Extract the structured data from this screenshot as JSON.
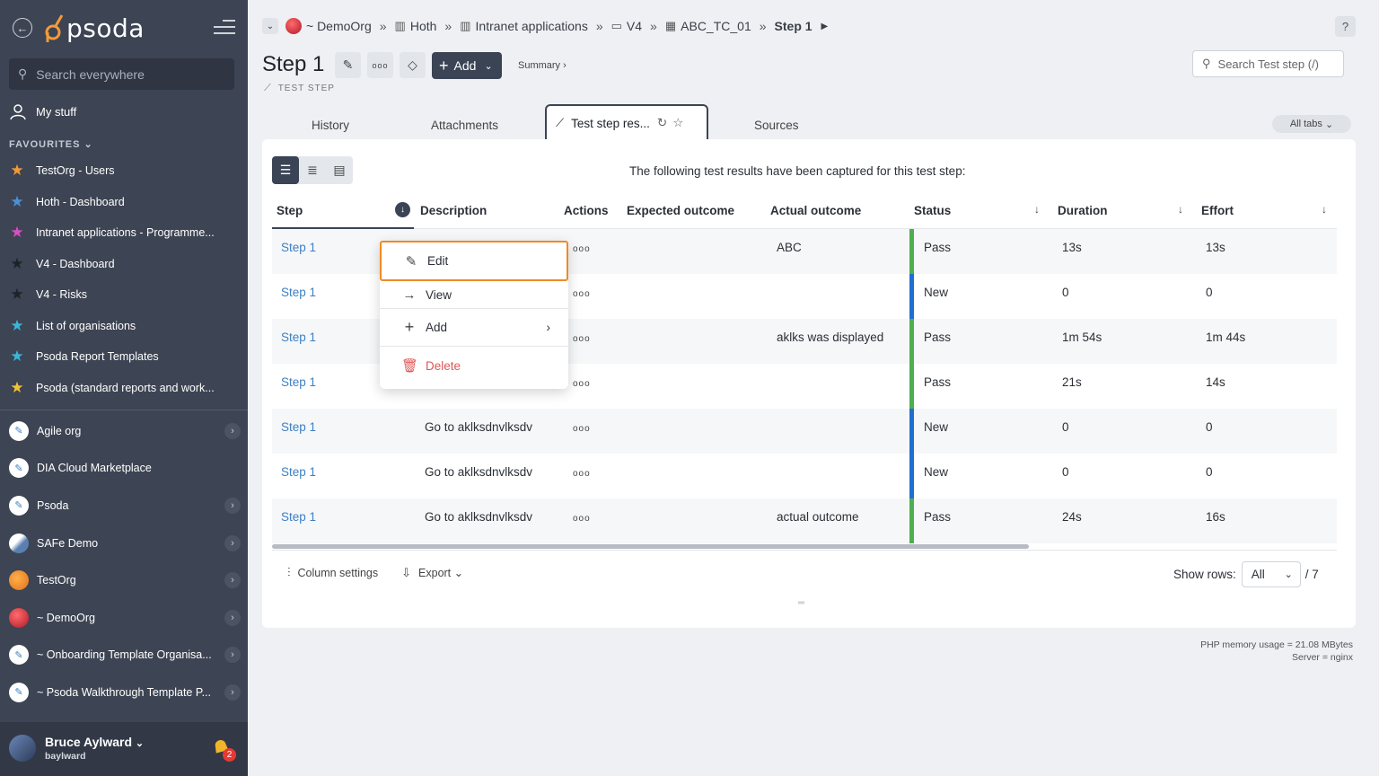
{
  "sidebar": {
    "logo_text": "psoda",
    "search_placeholder": "Search everywhere",
    "my_stuff": "My stuff",
    "favourites_heading": "FAVOURITES",
    "favourites": [
      {
        "label": "TestOrg - Users",
        "color": "#f39a3a"
      },
      {
        "label": "Hoth - Dashboard",
        "color": "#4a90d9"
      },
      {
        "label": "Intranet applications - Programme...",
        "color": "#d94fc2"
      },
      {
        "label": "V4 - Dashboard",
        "color": "#2b2f36"
      },
      {
        "label": "V4 - Risks",
        "color": "#2b2f36"
      },
      {
        "label": "List of organisations",
        "color": "#3bb6d8"
      },
      {
        "label": "Psoda Report Templates",
        "color": "#3bb6d8"
      },
      {
        "label": "Psoda (standard reports and work...",
        "color": "#f1c232"
      }
    ],
    "organisations": [
      {
        "label": "Agile org",
        "has_chevron": true
      },
      {
        "label": "DIA Cloud Marketplace",
        "has_chevron": false
      },
      {
        "label": "Psoda",
        "has_chevron": true
      },
      {
        "label": "SAFe Demo",
        "has_chevron": true
      },
      {
        "label": "TestOrg",
        "has_chevron": true
      },
      {
        "label": "~ DemoOrg",
        "has_chevron": true
      },
      {
        "label": "~ Onboarding Template Organisa...",
        "has_chevron": true
      },
      {
        "label": "~ Psoda Walkthrough Template P...",
        "has_chevron": true
      }
    ],
    "user": {
      "name": "Bruce Aylward",
      "handle": "baylward",
      "notifications": "2"
    }
  },
  "breadcrumb": [
    {
      "label": "~ DemoOrg",
      "icon": "org-icon"
    },
    {
      "label": "Hoth",
      "icon": "programme-icon"
    },
    {
      "label": "Intranet applications",
      "icon": "programme-icon"
    },
    {
      "label": "V4",
      "icon": "project-icon"
    },
    {
      "label": "ABC_TC_01",
      "icon": "test-case-icon"
    },
    {
      "label": "Step 1",
      "icon": ""
    }
  ],
  "header": {
    "title": "Step 1",
    "subtype": "TEST STEP",
    "add_label": "Add",
    "summary_label": "Summary ›",
    "search_placeholder": "Search Test step (/)",
    "help": "?"
  },
  "tabs": {
    "items": [
      "History",
      "Attachments",
      "Sources"
    ],
    "active": "Test step res...",
    "all_tabs": "All tabs"
  },
  "panel": {
    "intro": "The following test results have been captured for this test step:",
    "columns": [
      "Step",
      "Description",
      "Actions",
      "Expected outcome",
      "Actual outcome",
      "Status",
      "Duration",
      "Effort"
    ],
    "rows": [
      {
        "step": "Step 1",
        "description": "",
        "actions": "ooo",
        "expected": "",
        "actual": "ABC",
        "status": "Pass",
        "duration": "13s",
        "effort": "13s"
      },
      {
        "step": "Step 1",
        "description": "",
        "actions": "ooo",
        "expected": "",
        "actual": "",
        "status": "New",
        "duration": "0",
        "effort": "0"
      },
      {
        "step": "Step 1",
        "description": "",
        "actions": "ooo",
        "expected": "",
        "actual": "aklks was displayed",
        "status": "Pass",
        "duration": "1m 54s",
        "effort": "1m 44s"
      },
      {
        "step": "Step 1",
        "description": "",
        "actions": "ooo",
        "expected": "",
        "actual": "",
        "status": "Pass",
        "duration": "21s",
        "effort": "14s"
      },
      {
        "step": "Step 1",
        "description": "Go to aklksdnvlksdv",
        "actions": "ooo",
        "expected": "",
        "actual": "",
        "status": "New",
        "duration": "0",
        "effort": "0"
      },
      {
        "step": "Step 1",
        "description": "Go to aklksdnvlksdv",
        "actions": "ooo",
        "expected": "",
        "actual": "",
        "status": "New",
        "duration": "0",
        "effort": "0"
      },
      {
        "step": "Step 1",
        "description": "Go to aklksdnvlksdv",
        "actions": "ooo",
        "expected": "",
        "actual": "actual outcome",
        "status": "Pass",
        "duration": "24s",
        "effort": "16s"
      }
    ],
    "status_colors": {
      "Pass": "#4caf50",
      "New": "#1f6fd1"
    },
    "column_settings": "Column settings",
    "export": "Export",
    "show_rows_label": "Show rows:",
    "show_rows_value": "All",
    "total": "/ 7"
  },
  "context_menu": {
    "edit": "Edit",
    "view": "View",
    "add": "Add",
    "delete": "Delete"
  },
  "server_info": {
    "memory": "PHP memory usage = 21.08 MBytes",
    "server": "Server = nginx"
  }
}
